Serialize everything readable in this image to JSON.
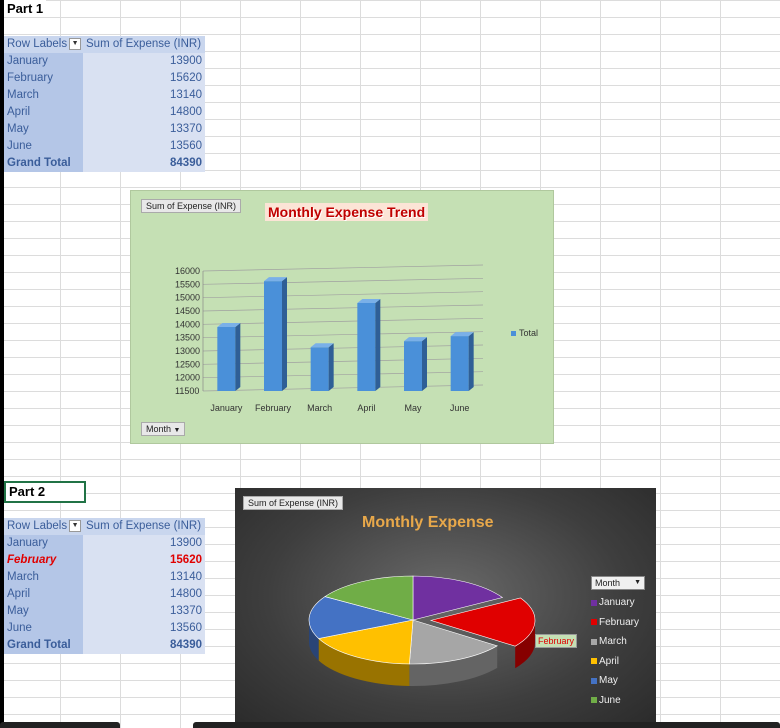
{
  "part1": {
    "label": "Part 1",
    "header": {
      "row_labels": "Row Labels",
      "sum": "Sum of Expense (INR)"
    },
    "rows": [
      {
        "month": "January",
        "value": "13900"
      },
      {
        "month": "February",
        "value": "15620"
      },
      {
        "month": "March",
        "value": "13140"
      },
      {
        "month": "April",
        "value": "14800"
      },
      {
        "month": "May",
        "value": "13370"
      },
      {
        "month": "June",
        "value": "13560"
      }
    ],
    "grand_total": {
      "label": "Grand Total",
      "value": "84390"
    }
  },
  "part2": {
    "label": "Part 2",
    "header": {
      "row_labels": "Row Labels",
      "sum": "Sum of Expense (INR)"
    },
    "rows": [
      {
        "month": "January",
        "value": "13900"
      },
      {
        "month": "February",
        "value": "15620"
      },
      {
        "month": "March",
        "value": "13140"
      },
      {
        "month": "April",
        "value": "14800"
      },
      {
        "month": "May",
        "value": "13370"
      },
      {
        "month": "June",
        "value": "13560"
      }
    ],
    "grand_total": {
      "label": "Grand Total",
      "value": "84390"
    }
  },
  "chart1": {
    "field_button": "Sum of Expense (INR)",
    "axis_field_button": "Month",
    "legend_label": "Total",
    "colors": {
      "bar": "#4a90d9",
      "background": "#c5e0b4",
      "title": "#c00000"
    }
  },
  "chart2": {
    "field_button": "Sum of Expense (INR)",
    "legend_field_button": "Month",
    "highlight_label": "February",
    "legend": [
      {
        "label": "January",
        "color": "#7030a0"
      },
      {
        "label": "February",
        "color": "#e00000"
      },
      {
        "label": "March",
        "color": "#a6a6a6"
      },
      {
        "label": "April",
        "color": "#ffc000"
      },
      {
        "label": "May",
        "color": "#4472c4"
      },
      {
        "label": "June",
        "color": "#70ad47"
      }
    ]
  },
  "chart_data": [
    {
      "type": "bar",
      "title": "Monthly Expense Trend",
      "categories": [
        "January",
        "February",
        "March",
        "April",
        "May",
        "June"
      ],
      "series": [
        {
          "name": "Total",
          "values": [
            13900,
            15620,
            13140,
            14800,
            13370,
            13560
          ]
        }
      ],
      "ylim": [
        11500,
        16000
      ],
      "yticks": [
        16000,
        15500,
        15000,
        14500,
        14000,
        13500,
        13000,
        12500,
        12000,
        11500
      ],
      "grid": true,
      "legend": "right"
    },
    {
      "type": "pie",
      "title": "Monthly Expense",
      "categories": [
        "January",
        "February",
        "March",
        "April",
        "May",
        "June"
      ],
      "values": [
        13900,
        15620,
        13140,
        14800,
        13370,
        13560
      ],
      "exploded": "February",
      "legend": "right"
    }
  ]
}
